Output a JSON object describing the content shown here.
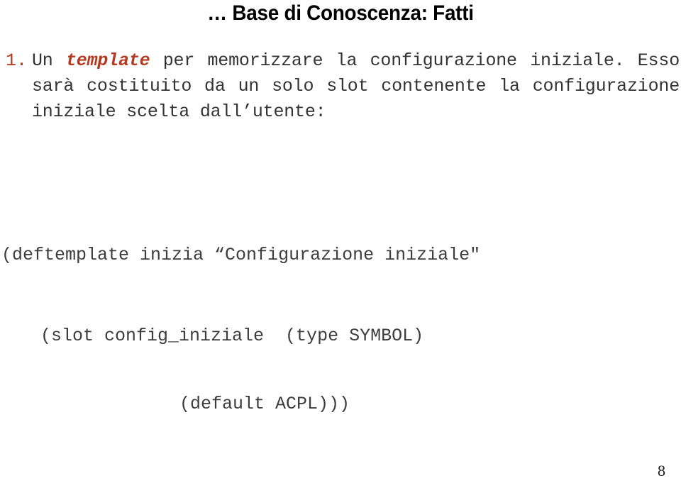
{
  "slide": {
    "title": "… Base di Conoscenza: Fatti",
    "background_color": "#FFFFFF",
    "body_color": "#333333",
    "accent_color": "#B5391E",
    "page_number": "8"
  },
  "list": {
    "number": "1.",
    "text_before_keyword": "Un ",
    "keyword": "template",
    "text_after_keyword": " per memorizzare la configurazione iniziale. Esso sarà costituito da un solo slot contenente la configurazione iniziale scelta dall’utente:"
  },
  "code": {
    "lines": [
      "(deftemplate inizia “Configurazione iniziale\"",
      "(slot config_iniziale  (type SYMBOL)",
      "(default ACPL)))"
    ]
  }
}
